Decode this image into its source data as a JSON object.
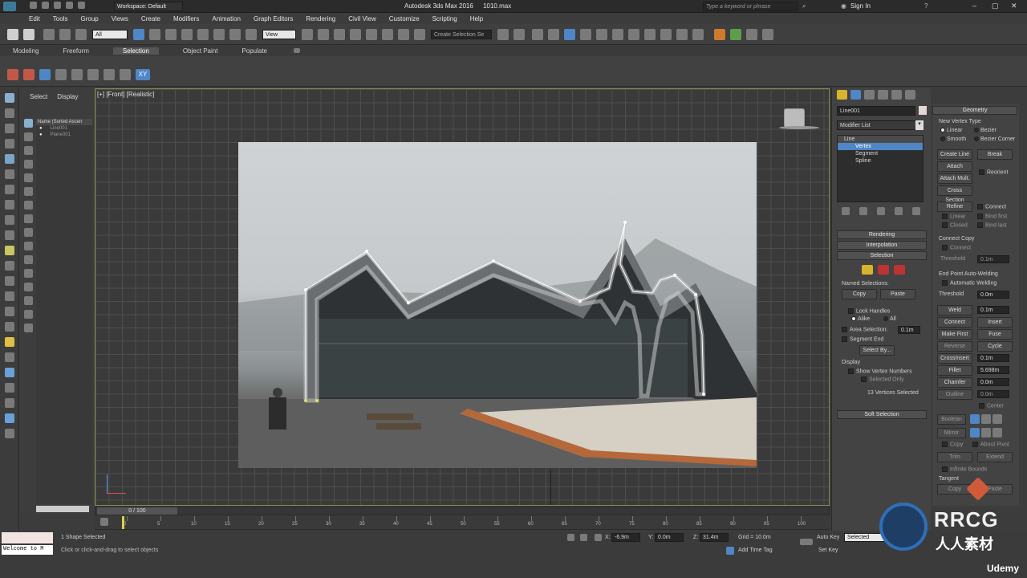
{
  "titlebar": {
    "workspace": "Workspace: Default",
    "app_title": "Autodesk 3ds Max 2016",
    "file_name": "1010.max",
    "search_placeholder": "Type a keyword or phrase",
    "sign_in": "Sign In"
  },
  "menu": [
    "Edit",
    "Tools",
    "Group",
    "Views",
    "Create",
    "Modifiers",
    "Animation",
    "Graph Editors",
    "Rendering",
    "Civil View",
    "Customize",
    "Scripting",
    "Help"
  ],
  "toolbar": {
    "filter_value": "All",
    "ref_coord": "View",
    "selection_set": "Create Selection Se"
  },
  "ribbon_tabs": [
    "Modeling",
    "Freeform",
    "Selection",
    "Object Paint",
    "Populate"
  ],
  "ribbon_active": "Selection",
  "scene_explorer": {
    "tabs": [
      "Select",
      "Display"
    ],
    "column": "Name (Sorted Ascen",
    "items": [
      "Line001",
      "Plane001"
    ]
  },
  "viewport": {
    "label": "[+] [Front] [Realistic]"
  },
  "modify_panel": {
    "object_name": "Line001",
    "modifier_list": "Modifier List",
    "stack": [
      "Line",
      "Vertex",
      "Segment",
      "Spline"
    ],
    "rollouts": {
      "rendering": "Rendering",
      "interpolation": "Interpolation",
      "selection": "Selection",
      "soft_selection": "Soft Selection"
    },
    "selection": {
      "named_selections": "Named Selections:",
      "copy": "Copy",
      "paste": "Paste",
      "lock_handles": "Lock Handles",
      "alike": "Alike",
      "all": "All",
      "area_selection": "Area Selection:",
      "area_value": "0.1m",
      "segment_end": "Segment End",
      "select_by": "Select By...",
      "display": "Display",
      "show_vertex_numbers": "Show Vertex Numbers",
      "selected_only": "Selected Only",
      "status": "13 Vertices Selected"
    }
  },
  "geometry_panel": {
    "title": "Geometry",
    "new_vertex_type": "New Vertex Type",
    "linear": "Linear",
    "bezier": "Bezier",
    "smooth": "Smooth",
    "bezier_corner": "Bezier Corner",
    "create_line": "Create Line",
    "break": "Break",
    "attach": "Attach",
    "reorient": "Reorient",
    "attach_mult": "Attach Mult.",
    "cross_section": "Cross Section",
    "refine": "Refine",
    "connect": "Connect",
    "linear2": "Linear",
    "bind_first": "Bind first",
    "closed": "Closed",
    "bind_last": "Bind last",
    "connect_copy": "Connect Copy",
    "connect2": "Connect",
    "threshold": "Threshold",
    "threshold_val": "0.1m",
    "endpoint_welding": "End Point Auto-Welding",
    "automatic_welding": "Automatic Welding",
    "threshold2": "Threshold",
    "threshold2_val": "0.0m",
    "weld": "Weld",
    "weld_val": "0.1m",
    "connect3": "Connect",
    "insert": "Insert",
    "make_first": "Make First",
    "fuse": "Fuse",
    "reverse": "Reverse",
    "cycle": "Cycle",
    "crossinsert": "CrossInsert",
    "crossinsert_val": "0.1m",
    "fillet": "Fillet",
    "fillet_val": "5.698m",
    "chamfer": "Chamfer",
    "chamfer_val": "0.0m",
    "outline": "Outline",
    "outline_val": "0.0m",
    "center": "Center",
    "boolean": "Boolean",
    "mirror": "Mirror",
    "copy": "Copy",
    "about_pivot": "About Pivot",
    "trim": "Trim",
    "extend": "Extend",
    "infinite_bounds": "Infinite Bounds",
    "tangent": "Tangent",
    "copy2": "Copy",
    "paste": "Paste"
  },
  "timeline": {
    "frame_counter": "0 / 100",
    "ticks": [
      "0",
      "5",
      "10",
      "15",
      "20",
      "25",
      "30",
      "35",
      "40",
      "45",
      "50",
      "55",
      "60",
      "65",
      "70",
      "75",
      "80",
      "85",
      "90",
      "95",
      "100"
    ]
  },
  "status": {
    "maxscript": "Welcome to M",
    "selected": "1 Shape Selected",
    "prompt": "Click or click-and-drag to select objects",
    "x_val": "-6.9m",
    "y_val": "0.0m",
    "z_val": "31.4m",
    "grid": "Grid = 10.0m",
    "add_time_tag": "Add Time Tag",
    "auto_key": "Auto Key",
    "set_key": "Set Key",
    "selected_dropdown": "Selected"
  },
  "watermarks": {
    "brand": "RRCG",
    "cn": "人人素材",
    "udemy": "Udemy"
  }
}
